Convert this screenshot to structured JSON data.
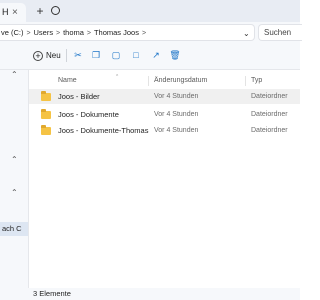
{
  "tabs": {
    "active_tab_label": "H",
    "close_glyph": "×",
    "add_glyph": "+"
  },
  "address_bar": {
    "breadcrumbs": [
      "ve (C:)",
      "Users",
      "thoma",
      "Thomas Joos"
    ],
    "separator": ">",
    "search_placeholder": "Suchen"
  },
  "command_bar": {
    "new_label": "Neu",
    "icons": [
      "cut-icon",
      "copy-icon",
      "paste-icon",
      "rename-icon",
      "share-icon",
      "delete-icon"
    ]
  },
  "sidebar": {
    "selected_item_label": "ach C"
  },
  "file_list": {
    "columns": {
      "name": "Name",
      "date": "Änderungsdatum",
      "type": "Typ"
    },
    "rows": [
      {
        "name": "Joos - Bilder",
        "date": "Vor 4 Stunden",
        "type": "Dateiordner",
        "selected": true
      },
      {
        "name": "Joos - Dokumente",
        "date": "Vor 4 Stunden",
        "type": "Dateiordner",
        "selected": false
      },
      {
        "name": "Joos - Dokumente-Thomas",
        "date": "Vor 4 Stunden",
        "type": "Dateiordner",
        "selected": false
      }
    ]
  },
  "status_bar": {
    "item_count": "3 Elemente"
  },
  "colors": {
    "accent": "#1a73c7",
    "folder": "#f5c344",
    "selection": "#dde6f2"
  }
}
